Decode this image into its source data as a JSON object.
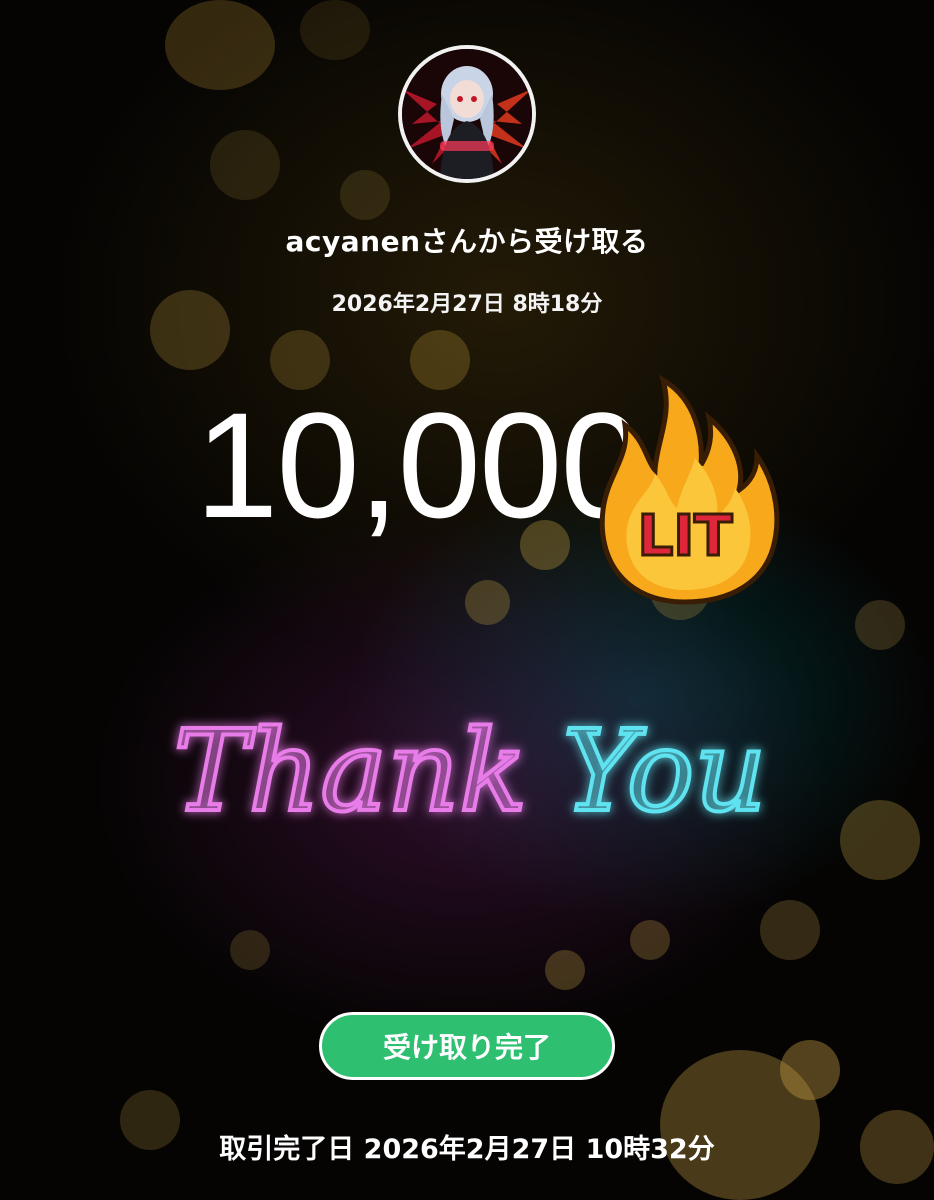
{
  "receipt": {
    "sender_line": "acyanenさんから受け取る",
    "sent_datetime": "2026年2月27日 8時18分",
    "amount": "10,000",
    "sticker": "LIT",
    "card_message": "Thank You",
    "status_label": "受け取り完了",
    "completed_datetime": "取引完了日 2026年2月27日 10時32分"
  },
  "colors": {
    "status_green": "#2fbf71",
    "neon_pink": "#e87ce8",
    "neon_cyan": "#5fe3f0",
    "flame_orange": "#f7a81b",
    "lit_red": "#e0263a"
  },
  "icons": {
    "avatar": "anime-avatar-icon",
    "sticker": "fire-lit-icon"
  }
}
